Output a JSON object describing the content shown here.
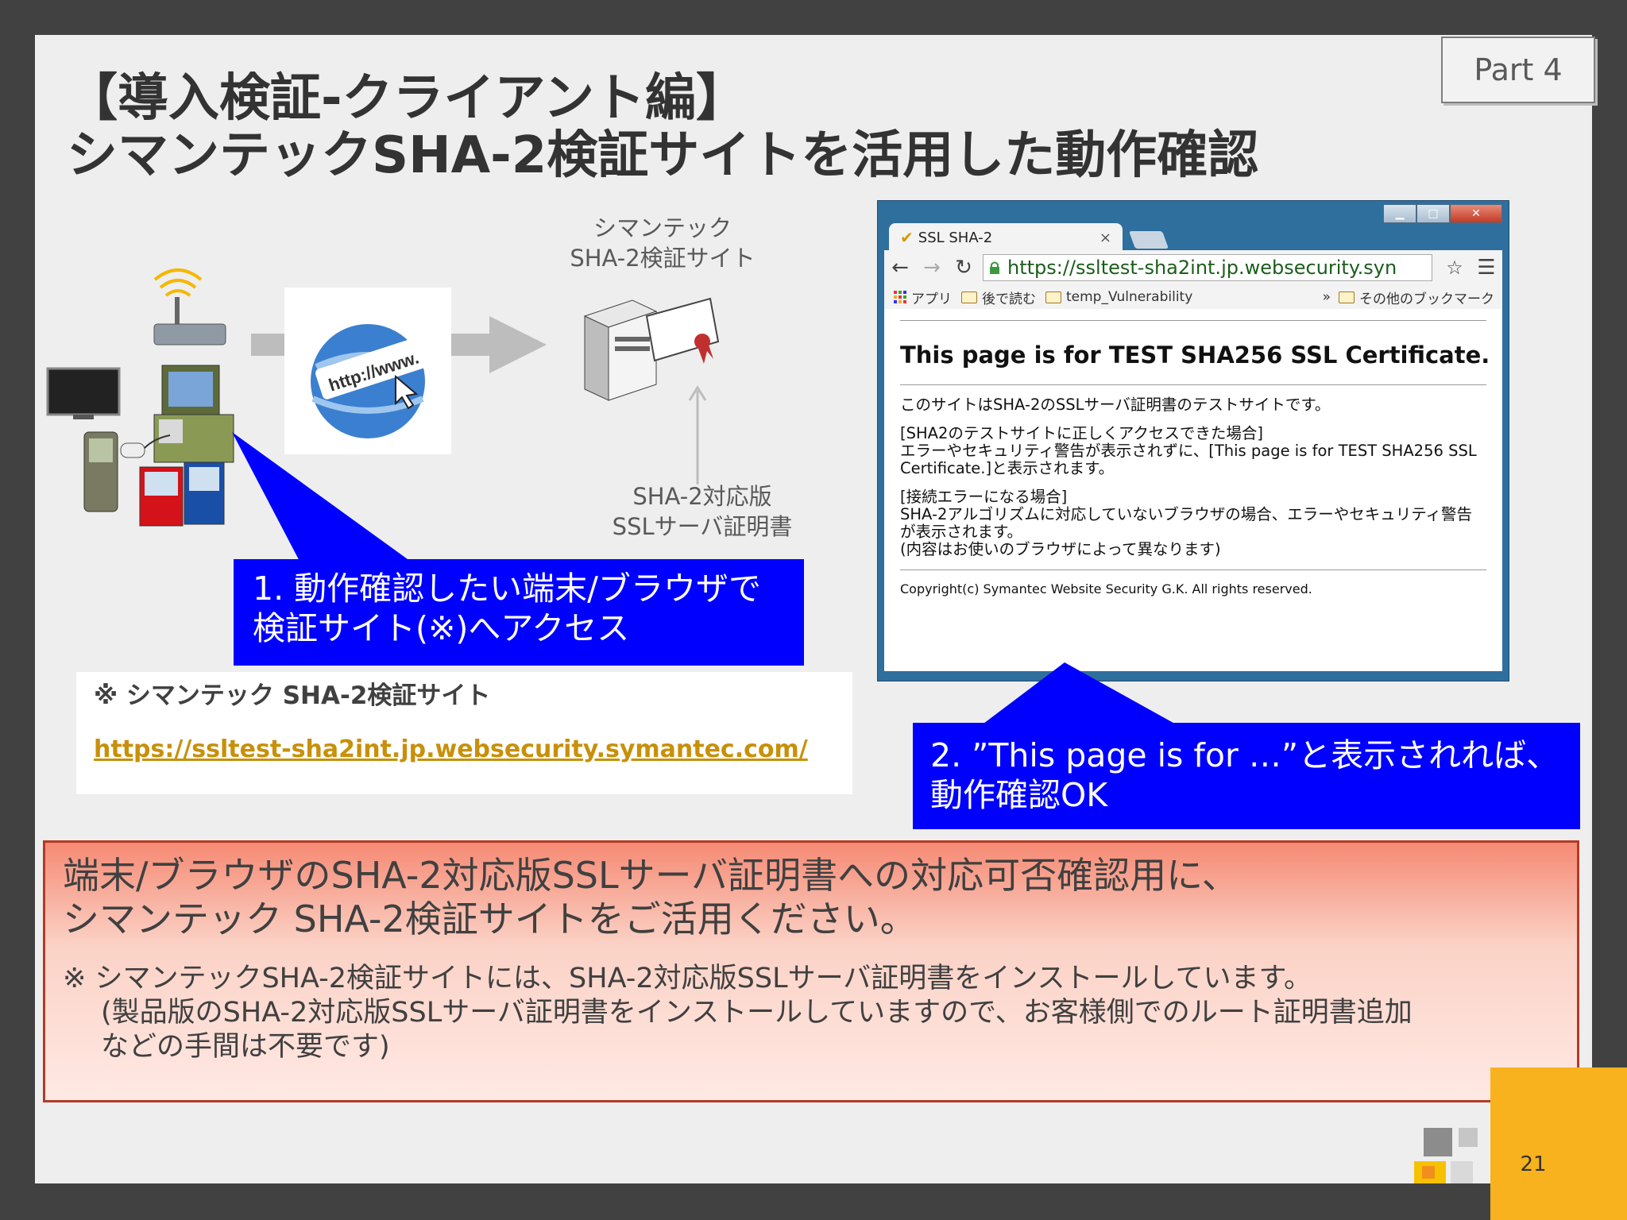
{
  "badge": "Part 4",
  "title": {
    "line1": "【導入検証-クライアント編】",
    "line2": "シマンテックSHA-2検証サイトを活用した動作確認"
  },
  "diagram": {
    "site_label_1": "シマンテック",
    "site_label_2": "SHA-2検証サイト",
    "cert_label_1": "SHA-2対応版",
    "cert_label_2": "SSLサーバ証明書",
    "globe_text": "http://www."
  },
  "callout1": {
    "line1": "1. 動作確認したい端末/ブラウザで",
    "line2": "検証サイト(※)へアクセス"
  },
  "note": {
    "title": "※ シマンテック SHA-2検証サイト",
    "link": "https://ssltest-sha2int.jp.websecurity.symantec.com/"
  },
  "browser": {
    "tab_title": "SSL SHA-2",
    "url": "https://ssltest-sha2int.jp.websecurity.syn",
    "bookmarks": [
      "アプリ",
      "後で読む",
      "temp_Vulnerability",
      "その他のブックマーク"
    ],
    "overflow": "»",
    "page_heading": "This page is for TEST SHA256 SSL Certificate.",
    "para1": "このサイトはSHA-2のSSLサーバ証明書のテストサイトです。",
    "para2_title": "[SHA2のテストサイトに正しくアクセスできた場合]",
    "para2_body": "エラーやセキュリティ警告が表示されずに、[This page is for TEST SHA256 SSL Certificate.]と表示されます。",
    "para3_title": "[接続エラーになる場合]",
    "para3_body": "SHA-2アルゴリズムに対応していないブラウザの場合、エラーやセキュリティ警告が表示されます。",
    "para3_note": "(内容はお使いのブラウザによって異なります)",
    "copyright": "Copyright(c) Symantec Website Security G.K. All rights reserved."
  },
  "callout2": {
    "line1": "2. ”This page is for …”と表示されれば、",
    "line2": "動作確認OK"
  },
  "bottom": {
    "line1": "端末/ブラウザのSHA-2対応版SSLサーバ証明書への対応可否確認用に、",
    "line2": "シマンテック SHA-2検証サイトをご活用ください。",
    "note1": "※ シマンテックSHA-2検証サイトには、SHA-2対応版SSLサーバ証明書をインストールしています。",
    "note2": "(製品版のSHA-2対応版SSLサーバ証明書をインストールしていますので、お客様側でのルート証明書追加",
    "note3": "などの手間は不要です)"
  },
  "page_number": "21",
  "colors": {
    "callout": "#0000ff",
    "link": "#c8900a",
    "accent": "#f7b21e",
    "bottom_border": "#b43a25"
  }
}
